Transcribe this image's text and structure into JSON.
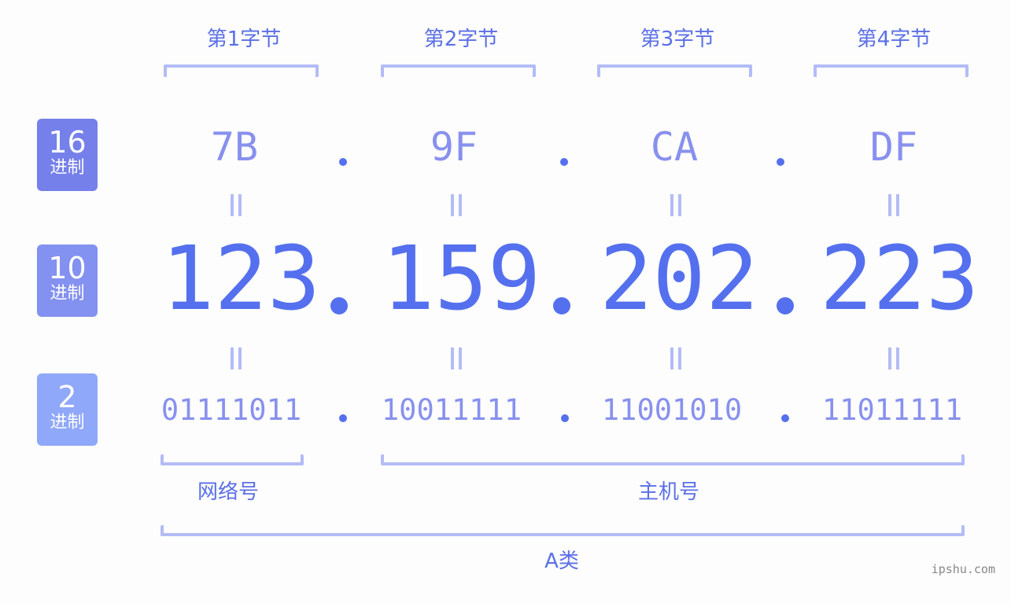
{
  "bytes": [
    {
      "title": "第1字节",
      "hex": "7B",
      "dec": "123",
      "bin": "01111011"
    },
    {
      "title": "第2字节",
      "hex": "9F",
      "dec": "159",
      "bin": "10011111"
    },
    {
      "title": "第3字节",
      "hex": "CA",
      "dec": "202",
      "bin": "11001010"
    },
    {
      "title": "第4字节",
      "hex": "DF",
      "dec": "223",
      "bin": "11011111"
    }
  ],
  "badges": [
    {
      "num": "16",
      "label": "进制",
      "color": "#7580ea"
    },
    {
      "num": "10",
      "label": "进制",
      "color": "#8391f0"
    },
    {
      "num": "2",
      "label": "进制",
      "color": "#8fa8f9"
    }
  ],
  "segments": {
    "network": "网络号",
    "host": "主机号",
    "class": "A类"
  },
  "watermark": "ipshu.com",
  "colors": {
    "accent": "#5570ee",
    "bracket": "#b3bcf7",
    "label": "#5b6fe6"
  }
}
